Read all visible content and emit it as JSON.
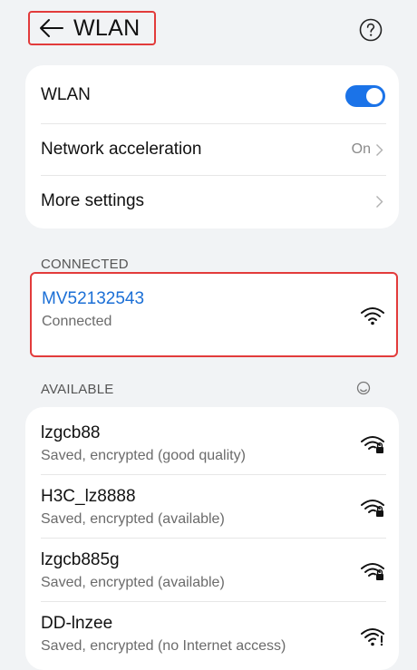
{
  "header": {
    "title": "WLAN"
  },
  "settings": {
    "wlan_label": "WLAN",
    "acceleration_label": "Network acceleration",
    "acceleration_value": "On",
    "more_label": "More settings"
  },
  "connected": {
    "section_label": "CONNECTED",
    "network": {
      "name": "MV52132543",
      "status": "Connected"
    }
  },
  "available": {
    "section_label": "AVAILABLE",
    "networks": [
      {
        "name": "lzgcb88",
        "status": "Saved, encrypted (good quality)"
      },
      {
        "name": "H3C_lz8888",
        "status": "Saved, encrypted (available)"
      },
      {
        "name": "lzgcb885g",
        "status": "Saved, encrypted (available)"
      },
      {
        "name": "DD-lnzee",
        "status": "Saved, encrypted (no Internet access)"
      }
    ]
  },
  "colors": {
    "accent": "#1b73e8",
    "highlight_border": "#e23b3b",
    "background": "#f1f3f5"
  }
}
